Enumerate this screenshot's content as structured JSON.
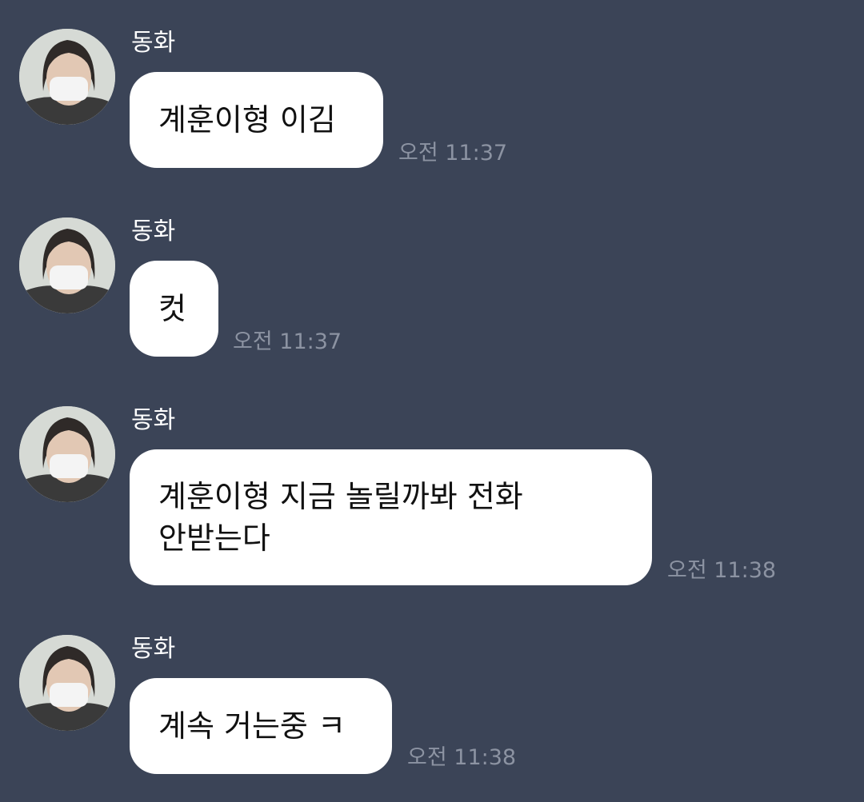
{
  "messages": [
    {
      "sender": "동화",
      "text": "계훈이형 이김",
      "time": "오전 11:37"
    },
    {
      "sender": "동화",
      "text": "컷",
      "time": "오전 11:37"
    },
    {
      "sender": "동화",
      "text": "계훈이형 지금 놀릴까봐 전화\n안받는다",
      "time": "오전 11:38"
    },
    {
      "sender": "동화",
      "text": "계속 거는중 ㅋ",
      "time": "오전 11:38"
    }
  ],
  "colors": {
    "background": "#3b4457",
    "bubble": "#ffffff",
    "time": "#8c93a2",
    "sender": "#ffffff"
  }
}
